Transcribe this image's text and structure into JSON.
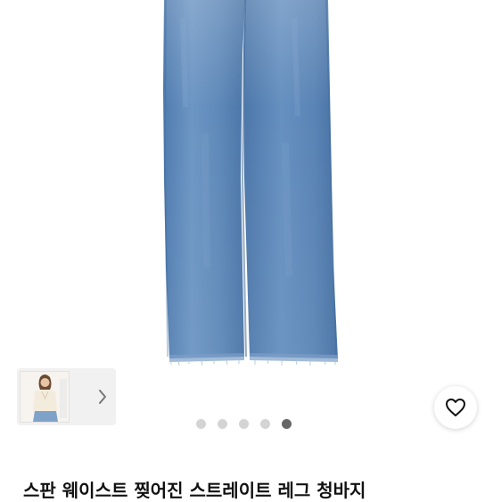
{
  "product": {
    "title": "스판 웨이스트 찢어진 스트레이트 레그 청바지"
  },
  "gallery": {
    "image_count": 5,
    "active_index": 4,
    "thumbnail_icon": "woman-in-white-top-thumbnail",
    "next_icon": "chevron-right-icon"
  },
  "actions": {
    "favorite_icon": "heart-outline-icon"
  },
  "colors": {
    "denim": "#5a85b5",
    "dot_inactive": "#d4d4d4",
    "dot_active": "#666666"
  }
}
